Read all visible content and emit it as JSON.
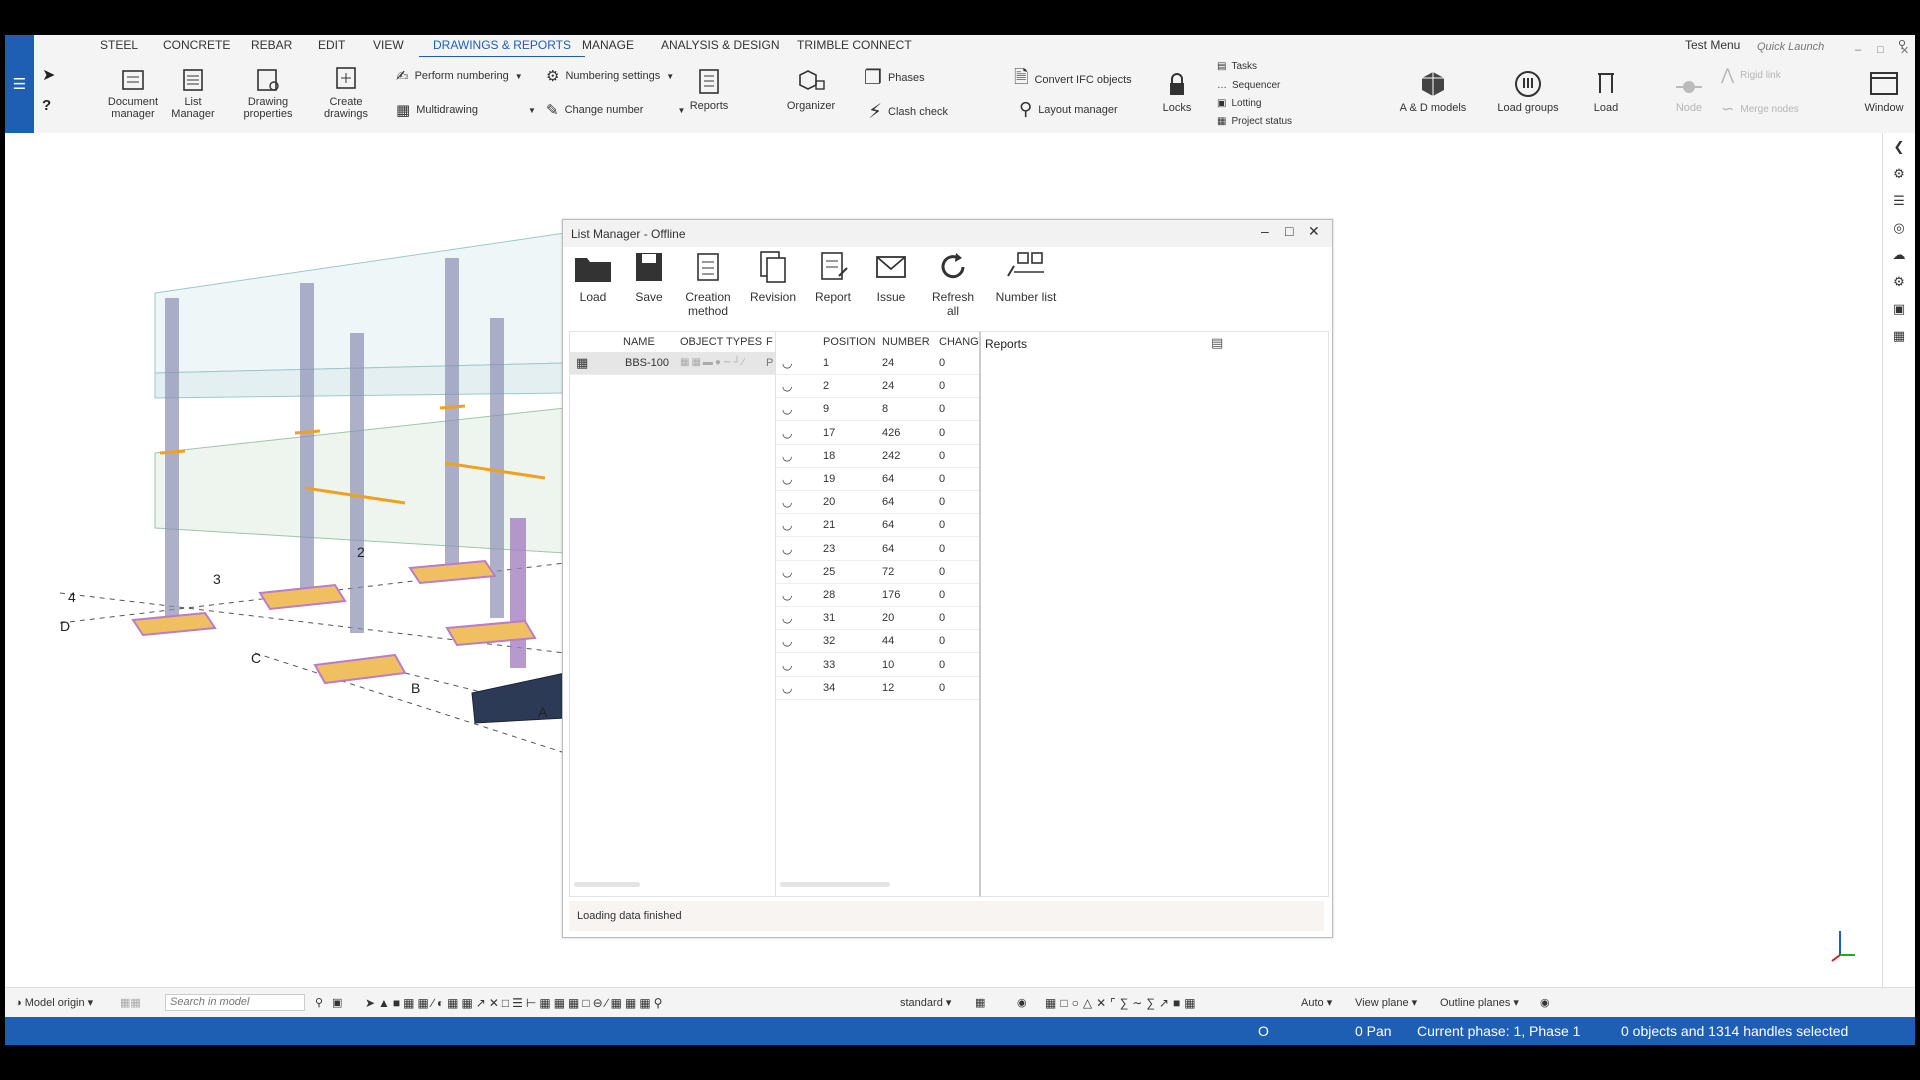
{
  "menu": {
    "tabs": [
      "STEEL",
      "CONCRETE",
      "REBAR",
      "EDIT",
      "VIEW",
      "DRAWINGS & REPORTS",
      "MANAGE",
      "ANALYSIS & DESIGN",
      "TRIMBLE CONNECT"
    ],
    "test_menu": "Test Menu",
    "quick_launch_placeholder": "Quick Launch"
  },
  "ribbon": {
    "document_manager": "Document manager",
    "list_manager": "List Manager",
    "drawing_properties": "Drawing properties",
    "create_drawings": "Create drawings",
    "perform_numbering": "Perform numbering",
    "numbering_settings": "Numbering settings",
    "multidrawing": "Multidrawing",
    "change_number": "Change number",
    "reports": "Reports",
    "organizer": "Organizer",
    "phases": "Phases",
    "clash_check": "Clash check",
    "convert_ifc": "Convert IFC objects",
    "layout_manager": "Layout manager",
    "locks": "Locks",
    "tasks": "Tasks",
    "sequencer": "Sequencer",
    "lotting": "Lotting",
    "project_status": "Project status",
    "ad_models": "A & D models",
    "load_groups": "Load groups",
    "load": "Load",
    "node": "Node",
    "rigid_link": "Rigid link",
    "merge_nodes": "Merge nodes",
    "window": "Window"
  },
  "grid_labels": [
    "4",
    "D",
    "3",
    "2",
    "C",
    "B",
    "A"
  ],
  "list_manager": {
    "title": "List Manager - Offline",
    "toolbar": {
      "load": "Load",
      "save": "Save",
      "creation_method": "Creation method",
      "revision": "Revision",
      "report": "Report",
      "issue": "Issue",
      "refresh_all": "Refresh all",
      "number_list": "Number list"
    },
    "left_table": {
      "headers": {
        "name": "NAME",
        "object_types": "OBJECT TYPES",
        "extra": "F"
      },
      "row": {
        "name": "BBS-100",
        "extra": "P"
      }
    },
    "right_table": {
      "headers": {
        "position": "POSITION",
        "number": "NUMBER",
        "changes": "CHANGES"
      },
      "rows": [
        {
          "position": "1",
          "number": "24",
          "changes": "0"
        },
        {
          "position": "2",
          "number": "24",
          "changes": "0"
        },
        {
          "position": "9",
          "number": "8",
          "changes": "0"
        },
        {
          "position": "17",
          "number": "426",
          "changes": "0"
        },
        {
          "position": "18",
          "number": "242",
          "changes": "0"
        },
        {
          "position": "19",
          "number": "64",
          "changes": "0"
        },
        {
          "position": "20",
          "number": "64",
          "changes": "0"
        },
        {
          "position": "21",
          "number": "64",
          "changes": "0"
        },
        {
          "position": "23",
          "number": "64",
          "changes": "0"
        },
        {
          "position": "25",
          "number": "72",
          "changes": "0"
        },
        {
          "position": "28",
          "number": "176",
          "changes": "0"
        },
        {
          "position": "31",
          "number": "20",
          "changes": "0"
        },
        {
          "position": "32",
          "number": "44",
          "changes": "0"
        },
        {
          "position": "33",
          "number": "10",
          "changes": "0"
        },
        {
          "position": "34",
          "number": "12",
          "changes": "0"
        }
      ]
    },
    "reports_label": "Reports",
    "status": "Loading data finished"
  },
  "bottom_toolbar": {
    "model_origin": "Model origin",
    "search_placeholder": "Search in model",
    "standard": "standard",
    "auto": "Auto",
    "view_plane": "View plane",
    "outline_planes": "Outline planes"
  },
  "statusbar": {
    "o": "O",
    "pan": "0  Pan",
    "phase": "Current phase: 1, Phase 1",
    "selection": "0 objects and 1314 handles selected"
  },
  "colors": {
    "accent": "#1e5fb4",
    "rebar_orange": "#f0a020",
    "column_purple": "#9b59b6"
  }
}
